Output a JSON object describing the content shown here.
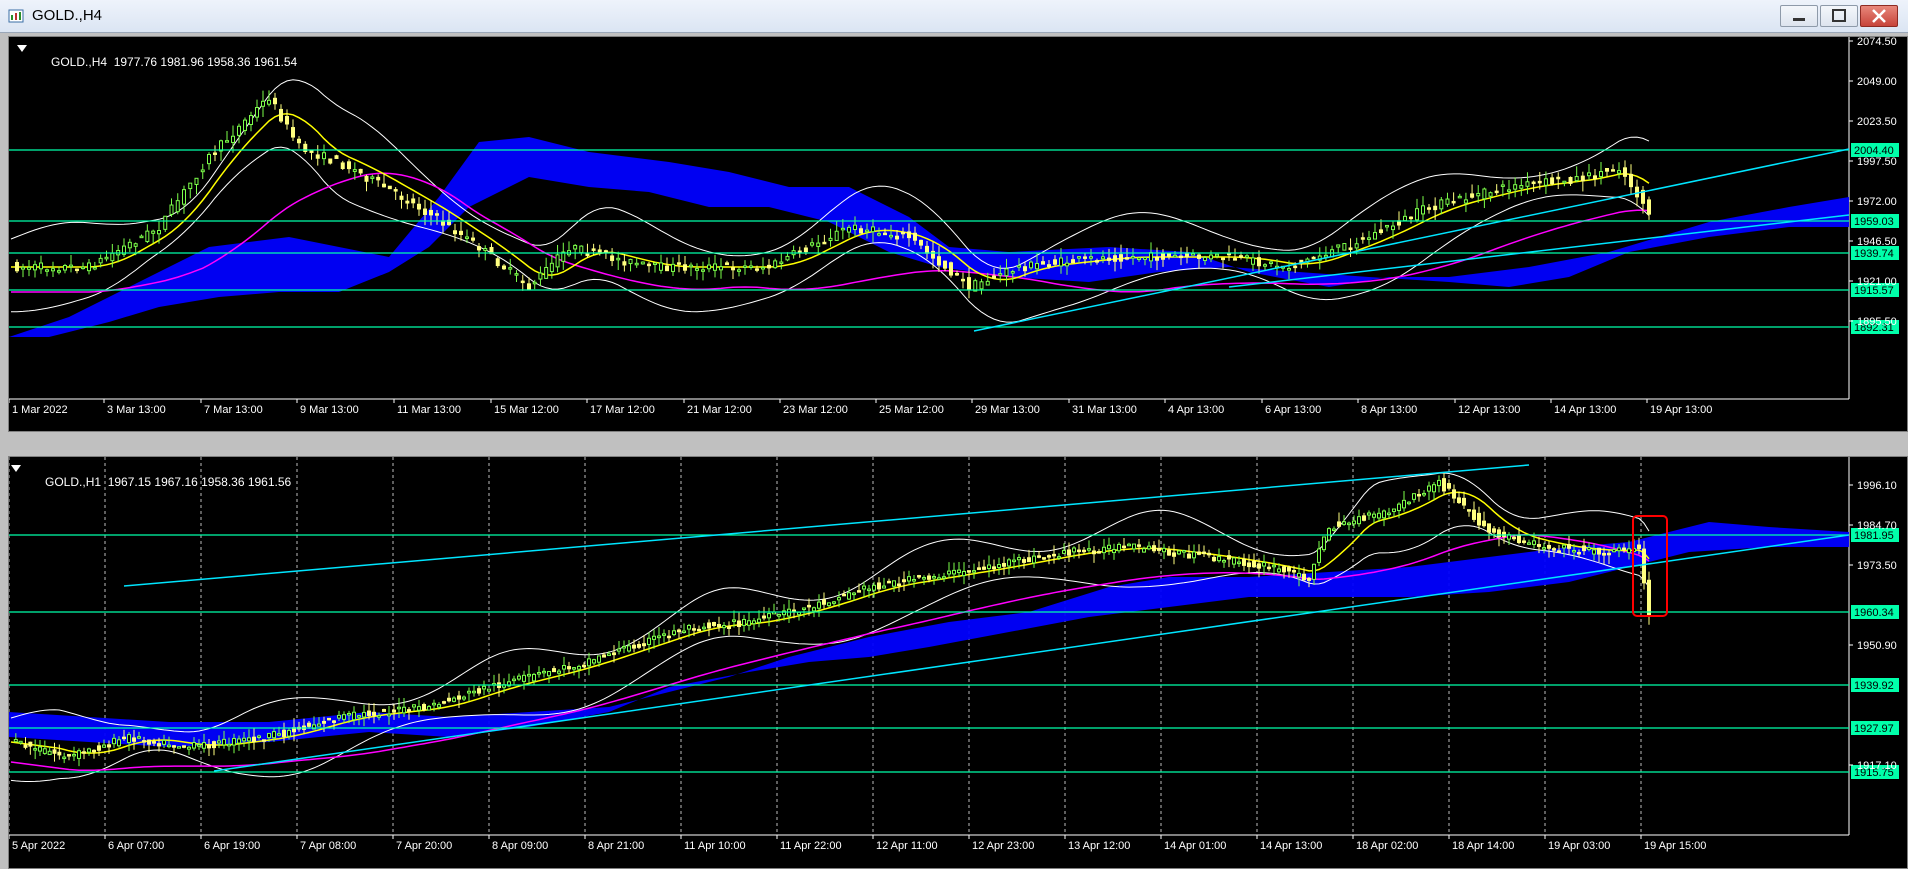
{
  "window": {
    "title": "GOLD.,H4",
    "icon": "chart-window-icon",
    "buttons": [
      "minimize-icon",
      "maximize-icon",
      "close-icon"
    ]
  },
  "colors": {
    "background": "#000000",
    "bull_candle": "#7cff4a",
    "bear_candle": "#ffff80",
    "cloud": "#0000ff",
    "level_line": "#00ffaa",
    "trend_line": "#00e5ff",
    "ma_yellow": "#ffff00",
    "ma_magenta": "#ff00ff",
    "bands": "#ffffff",
    "highlight_box": "#ff0000"
  },
  "chart_top": {
    "symbol": "GOLD.,H4",
    "ohlc": "1977.76 1981.96 1958.36 1961.54",
    "price_ticks": [
      "2074.50",
      "2049.00",
      "2023.50",
      "1997.50",
      "1972.00",
      "1946.50",
      "1921.00",
      "1895.50"
    ],
    "level_labels": [
      "2004.40",
      "1959.03",
      "1939.74",
      "1915.57",
      "1892.31"
    ],
    "time_labels": [
      "1 Mar 2022",
      "3 Mar 13:00",
      "7 Mar 13:00",
      "9 Mar 13:00",
      "11 Mar 13:00",
      "15 Mar 12:00",
      "17 Mar 12:00",
      "21 Mar 12:00",
      "23 Mar 12:00",
      "25 Mar 12:00",
      "29 Mar 13:00",
      "31 Mar 13:00",
      "4 Apr 13:00",
      "6 Apr 13:00",
      "8 Apr 13:00",
      "12 Apr 13:00",
      "14 Apr 13:00",
      "19 Apr 13:00"
    ]
  },
  "chart_bottom": {
    "symbol": "GOLD.,H1",
    "ohlc": "1967.15 1967.16 1958.36 1961.56",
    "price_ticks": [
      "1996.10",
      "1984.70",
      "1973.50",
      "1950.90",
      "1917.10"
    ],
    "level_labels": [
      "1981.95",
      "1960.34",
      "1939.92",
      "1927.97",
      "1915.75"
    ],
    "time_labels": [
      "5 Apr 2022",
      "6 Apr 07:00",
      "6 Apr 19:00",
      "7 Apr 08:00",
      "7 Apr 20:00",
      "8 Apr 09:00",
      "8 Apr 21:00",
      "11 Apr 10:00",
      "11 Apr 22:00",
      "12 Apr 11:00",
      "12 Apr 23:00",
      "13 Apr 12:00",
      "14 Apr 01:00",
      "14 Apr 13:00",
      "18 Apr 02:00",
      "18 Apr 14:00",
      "19 Apr 03:00",
      "19 Apr 15:00"
    ]
  }
}
